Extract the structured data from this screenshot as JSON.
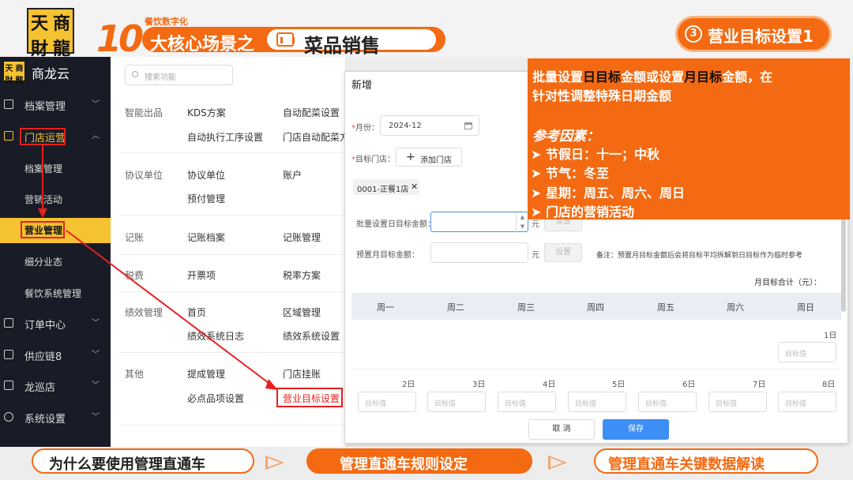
{
  "banner": {
    "logo_chars": [
      "天",
      "商",
      "財",
      "龍"
    ],
    "big_number": "10",
    "subtitle": "餐饮数字化",
    "title_prefix": "大核心场景之",
    "title_main": "菜品销售",
    "step_number": "3",
    "step_title": "营业目标设置1"
  },
  "sidebar": {
    "brand": "商龙云",
    "logo_chars": [
      "天",
      "商",
      "財",
      "龍"
    ],
    "items": [
      {
        "label": "档案管理",
        "icon": "folder-icon"
      },
      {
        "label": "门店运营",
        "icon": "store-icon"
      },
      {
        "label": "档案管理"
      },
      {
        "label": "营销活动"
      },
      {
        "label": "营业管理"
      },
      {
        "label": "细分业态"
      },
      {
        "label": "餐饮系统管理"
      },
      {
        "label": "订单中心",
        "icon": "order-icon"
      },
      {
        "label": "供应链8",
        "icon": "truck-icon"
      },
      {
        "label": "龙巡店",
        "icon": "inspect-icon"
      },
      {
        "label": "系统设置",
        "icon": "gear-icon"
      }
    ]
  },
  "content": {
    "search_placeholder": "搜索功能",
    "sections": [
      {
        "category": "智能出品",
        "links": [
          "KDS方案",
          "自动配菜设置",
          "自动执行工序设置",
          "门店自动配菜方"
        ]
      },
      {
        "category": "协议单位",
        "links": [
          "协议单位",
          "账户",
          "预付管理"
        ]
      },
      {
        "category": "记账",
        "links": [
          "记账档案",
          "记账管理"
        ]
      },
      {
        "category": "税费",
        "links": [
          "开票项",
          "税率方案"
        ]
      },
      {
        "category": "绩效管理",
        "links": [
          "首页",
          "区域管理",
          "绩效系统日志",
          "绩效系统设置"
        ]
      },
      {
        "category": "其他",
        "links": [
          "提成管理",
          "门店挂账",
          "必点品项设置",
          "营业目标设置"
        ]
      }
    ]
  },
  "modal": {
    "title": "新增",
    "month_label": "月份：",
    "month_value": "2024-12",
    "store_label": "目标门店：",
    "add_store_label": "添加门店",
    "store_tag": "0001-正餐1店",
    "daily_batch_label": "批量设置日目标金额：",
    "monthly_preset_label": "预置月目标金额：",
    "unit": "元",
    "set_button": "设置",
    "note": "备注：预置月目标金额后会将目标平均拆解到日目标作为临时参考",
    "month_total_label": "月目标合计（元）：",
    "weekdays": [
      "周一",
      "周二",
      "周三",
      "周四",
      "周五",
      "周六",
      "周日"
    ],
    "first_day": "1日",
    "week2_days": [
      "2日",
      "3日",
      "4日",
      "5日",
      "6日",
      "7日",
      "8日"
    ],
    "goal_placeholder": "目标值",
    "cancel_label": "取 消",
    "save_label": "保存"
  },
  "callout": {
    "line1_a": "批量设置",
    "line1_b": "日目标",
    "line1_c": "金额或设置",
    "line1_d": "月目标",
    "line1_e": "金额，在",
    "line2": "针对性调整特殊日期金额",
    "ref_title": "参考因素：",
    "factors": [
      "节假日：十一；中秋",
      "节气：冬至",
      "星期：周五、周六、周日",
      "门店的营销活动"
    ]
  },
  "bottom": {
    "nav1": "为什么要使用管理直通车",
    "nav2": "管理直通车规则设定",
    "nav3": "管理直通车关键数据解读"
  },
  "colors": {
    "accent": "#f36a12",
    "sidebar_bg": "#191c26",
    "highlight": "#f5c232",
    "primary_button": "#3d8ef5"
  }
}
